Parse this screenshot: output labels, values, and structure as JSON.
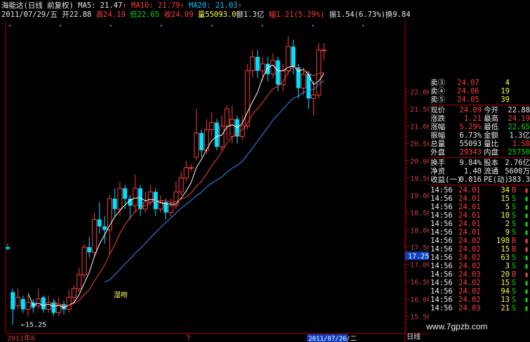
{
  "header": {
    "title": "海能达(日线 前复权)",
    "ma5_label": "MA5: 21.47",
    "ma10_label": "MA10: 21.79",
    "ma20_label": "MA20: 21.03",
    "date": "2011/07/29/五",
    "open_label": "开22.88",
    "high_label": "高24.19",
    "low_label": "低22.65",
    "close_label": "收24.09",
    "vol_label": "量55093.0",
    "amount_label": "额1.3亿",
    "change_label": "幅1.21(5.29%)",
    "amp_label": "振1.54(6.73%)",
    "turnover_label": "换9.84"
  },
  "chart": {
    "y_ticks": [
      "22.00",
      "21.50",
      "21.00",
      "20.50",
      "20.00",
      "19.50",
      "19.00",
      "18.50",
      "18.00",
      "17.50",
      "17.00",
      "16.50",
      "16.00",
      "15.50"
    ],
    "current_price_tag": "17.25",
    "annotation_low": "←15.25",
    "annotation_kiss": "湿吻",
    "x_labels": [
      "2011年6",
      "7",
      "2011/07/26/二"
    ],
    "period_tab": "日线",
    "colors": {
      "up": "#ff3c3c",
      "down": "#00e0ff",
      "ma5": "#ffffff",
      "ma10": "#ff3c3c",
      "ma20": "#3a8cff",
      "axis": "#b00000"
    }
  },
  "chart_data": {
    "type": "candlestick",
    "series": [
      {
        "name": "MA5: 21.47",
        "values": []
      },
      {
        "name": "MA10: 21.79",
        "values": []
      },
      {
        "name": "MA20: 21.03",
        "values": []
      }
    ],
    "candles": [
      [
        17.5,
        17.45,
        17.6,
        17.4
      ],
      [
        16.2,
        15.7,
        16.3,
        15.25
      ],
      [
        15.8,
        16.05,
        16.3,
        15.7
      ],
      [
        16.0,
        15.7,
        16.1,
        15.6
      ],
      [
        15.7,
        15.9,
        16.1,
        15.5
      ],
      [
        15.9,
        15.75,
        16.0,
        15.6
      ],
      [
        15.8,
        16.0,
        16.3,
        15.7
      ],
      [
        16.05,
        15.7,
        16.1,
        15.6
      ],
      [
        15.7,
        15.9,
        16.1,
        15.6
      ],
      [
        15.9,
        15.6,
        16.0,
        15.5
      ],
      [
        15.6,
        15.85,
        16.05,
        15.5
      ],
      [
        15.85,
        15.7,
        15.95,
        15.55
      ],
      [
        15.7,
        16.05,
        16.25,
        15.6
      ],
      [
        16.05,
        16.3,
        16.4,
        15.9
      ],
      [
        16.3,
        16.7,
        16.9,
        16.2
      ],
      [
        16.7,
        17.5,
        17.6,
        16.6
      ],
      [
        17.5,
        17.35,
        17.8,
        17.2
      ],
      [
        17.35,
        18.3,
        18.5,
        17.2
      ],
      [
        18.3,
        18.1,
        18.8,
        17.9
      ],
      [
        18.1,
        18.0,
        18.4,
        17.6
      ],
      [
        18.0,
        18.9,
        19.0,
        17.3
      ],
      [
        18.9,
        18.6,
        19.2,
        18.4
      ],
      [
        18.6,
        19.2,
        19.4,
        18.4
      ],
      [
        19.2,
        18.9,
        19.3,
        18.6
      ],
      [
        18.9,
        18.7,
        19.0,
        18.3
      ],
      [
        18.7,
        19.2,
        19.6,
        18.5
      ],
      [
        19.2,
        18.6,
        19.3,
        18.4
      ],
      [
        18.6,
        18.8,
        19.1,
        18.5
      ],
      [
        18.8,
        19.1,
        19.3,
        18.7
      ],
      [
        19.1,
        18.6,
        19.2,
        18.4
      ],
      [
        18.6,
        18.8,
        19.0,
        18.5
      ],
      [
        18.8,
        18.5,
        18.9,
        18.3
      ],
      [
        18.5,
        18.7,
        18.9,
        18.4
      ],
      [
        18.7,
        19.1,
        19.4,
        18.6
      ],
      [
        19.1,
        19.5,
        19.7,
        19.0
      ],
      [
        19.5,
        19.8,
        20.0,
        19.4
      ],
      [
        19.8,
        19.8,
        19.9,
        19.7
      ],
      [
        20.1,
        20.8,
        21.5,
        20.0
      ],
      [
        20.8,
        20.3,
        20.9,
        20.1
      ],
      [
        20.3,
        20.9,
        21.2,
        20.2
      ],
      [
        20.9,
        21.1,
        21.4,
        20.7
      ],
      [
        21.1,
        20.4,
        21.2,
        20.3
      ],
      [
        20.4,
        21.0,
        21.3,
        20.3
      ],
      [
        21.0,
        21.5,
        21.6,
        20.6
      ],
      [
        20.7,
        21.2,
        21.6,
        20.5
      ],
      [
        21.2,
        20.7,
        21.3,
        20.5
      ],
      [
        20.7,
        21.0,
        21.3,
        20.6
      ],
      [
        21.0,
        22.6,
        22.8,
        20.9
      ],
      [
        22.6,
        23.0,
        23.2,
        22.4
      ],
      [
        23.0,
        22.6,
        23.2,
        22.4
      ],
      [
        22.6,
        22.8,
        23.0,
        22.3
      ],
      [
        22.8,
        22.5,
        23.0,
        22.3
      ],
      [
        22.5,
        22.9,
        23.1,
        22.4
      ],
      [
        22.9,
        22.2,
        23.0,
        22.0
      ],
      [
        22.2,
        22.6,
        22.8,
        22.0
      ],
      [
        22.6,
        23.3,
        23.6,
        22.5
      ],
      [
        23.3,
        22.7,
        23.5,
        22.5
      ],
      [
        22.7,
        22.1,
        22.8,
        21.8
      ],
      [
        22.1,
        22.5,
        22.7,
        21.9
      ],
      [
        22.5,
        21.8,
        22.6,
        21.5
      ],
      [
        21.8,
        21.9,
        22.3,
        21.3
      ],
      [
        21.9,
        23.2,
        23.4,
        21.8
      ],
      [
        23.2,
        23.2,
        23.4,
        22.9
      ]
    ]
  },
  "quote": {
    "asks": [
      {
        "label": "卖③",
        "price": "24.07",
        "vol": "4"
      },
      {
        "label": "卖④",
        "price": "24.06",
        "vol": "19"
      },
      {
        "label": "卖⑤",
        "price": "24.05",
        "vol": "39"
      }
    ],
    "stats": [
      {
        "l1": "现价",
        "v1": "24.09",
        "c1": "r",
        "l2": "今开",
        "v2": "22.88",
        "c2": "w"
      },
      {
        "l1": "涨跌",
        "v1": "1.21",
        "c1": "r",
        "l2": "最高",
        "v2": "24.19",
        "c2": "r"
      },
      {
        "l1": "涨幅",
        "v1": "5.29%",
        "c1": "r",
        "l2": "最低",
        "v2": "22.65",
        "c2": "g"
      },
      {
        "l1": "振幅",
        "v1": "6.73%",
        "c1": "w",
        "l2": "金额",
        "v2": "1.3亿",
        "c2": "w"
      },
      {
        "l1": "总量",
        "v1": "55093",
        "c1": "w",
        "l2": "量比",
        "v2": "1.58",
        "c2": "r"
      },
      {
        "l1": "外盘",
        "v1": "29343",
        "c1": "r",
        "l2": "内盘",
        "v2": "25750",
        "c2": "g"
      }
    ],
    "fund": [
      {
        "l1": "换手",
        "v1": "9.84%",
        "l2": "股本",
        "v2": "2.76亿"
      },
      {
        "l1": "净资",
        "v1": "1.40",
        "l2": "流通",
        "v2": "5600万"
      },
      {
        "l1": "收益(一)",
        "v1": "0.016",
        "l2": "PE(动)",
        "v2": "383.3"
      }
    ],
    "ticks": [
      {
        "t": "14:56",
        "p": "24.01",
        "v": "34",
        "s": "B"
      },
      {
        "t": "14:56",
        "p": "24.01",
        "v": "15",
        "s": "S"
      },
      {
        "t": "14:56",
        "p": "24.01",
        "v": "5",
        "s": "S"
      },
      {
        "t": "14:56",
        "p": "24.01",
        "v": "10",
        "s": "S"
      },
      {
        "t": "14:56",
        "p": "24.01",
        "v": "2",
        "s": "S"
      },
      {
        "t": "14:56",
        "p": "24.01",
        "v": "9",
        "s": "S"
      },
      {
        "t": "14:56",
        "p": "24.02",
        "v": "198",
        "s": "B"
      },
      {
        "t": "14:56",
        "p": "24.02",
        "v": "15",
        "s": "B"
      },
      {
        "t": "14:56",
        "p": "24.02",
        "v": "63",
        "s": "S"
      },
      {
        "t": "14:56",
        "p": "24.02",
        "v": "3",
        "s": "S"
      },
      {
        "t": "14:56",
        "p": "24.03",
        "v": "20",
        "s": "B"
      },
      {
        "t": "14:56",
        "p": "24.02",
        "v": "15",
        "s": "S"
      },
      {
        "t": "14:56",
        "p": "24.02",
        "v": "94",
        "s": "S"
      },
      {
        "t": "14:56",
        "p": "24.02",
        "v": "13",
        "s": "S"
      },
      {
        "t": "14:56",
        "p": "24.03",
        "v": "21",
        "s": "S"
      }
    ]
  },
  "watermark": "www.7gpzb.com"
}
